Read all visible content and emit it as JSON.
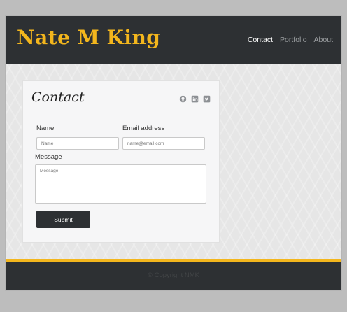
{
  "site": {
    "brand": "Nate M King"
  },
  "nav": {
    "items": [
      "Contact",
      "Portfolio",
      "About"
    ],
    "active": "Contact"
  },
  "contact": {
    "title": "Contact",
    "social_icons": [
      "github-icon",
      "linkedin-icon",
      "twitter-icon"
    ],
    "fields": {
      "name_label": "Name",
      "name_placeholder": "Name",
      "email_label": "Email address",
      "email_placeholder": "name@email.com",
      "message_label": "Message",
      "message_placeholder": "Message"
    },
    "submit_label": "Submit"
  },
  "footer": {
    "copyright": "© Copyright NMK"
  },
  "colors": {
    "accent": "#f3b61d",
    "dark": "#2d3033",
    "page_bg": "#e3e3e3"
  }
}
